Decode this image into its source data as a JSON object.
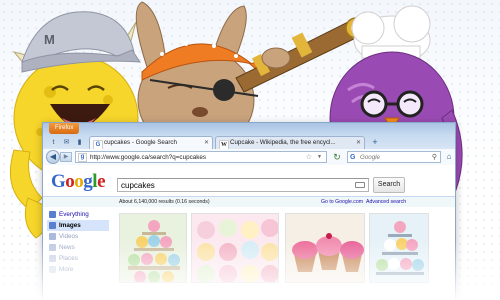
{
  "browser": {
    "app_menu_label": "Firefox",
    "tabs": [
      {
        "title": "cupcakes - Google Search",
        "favicon": "G"
      },
      {
        "title": "Cupcake - Wikipedia, the free encycl...",
        "favicon": "W"
      }
    ],
    "new_tab_label": "+",
    "address": "http://www.google.ca/search?q=cupcakes",
    "url_favicon": "g",
    "web_search_engine": "G",
    "web_search_placeholder": "Google"
  },
  "google": {
    "logo_letters": [
      {
        "ch": "G",
        "color": "#3366cc"
      },
      {
        "ch": "o",
        "color": "#cc2222"
      },
      {
        "ch": "o",
        "color": "#e8a900"
      },
      {
        "ch": "g",
        "color": "#3366cc"
      },
      {
        "ch": "l",
        "color": "#2a9a2a"
      },
      {
        "ch": "e",
        "color": "#cc2222"
      }
    ],
    "query": "cupcakes",
    "search_button": "Search",
    "results_count": "About 6,140,000 results (0.16 seconds)",
    "goto_link": "Go to Google.com",
    "advanced_link": "Advanced search"
  },
  "sidebar": [
    {
      "label": "Everything",
      "icon_color": "#5b7fcf"
    },
    {
      "label": "Images",
      "icon_color": "#5b7fcf",
      "selected": true
    },
    {
      "label": "Videos",
      "icon_color": "#8da3d4"
    },
    {
      "label": "News",
      "icon_color": "#a9b8d8"
    },
    {
      "label": "Places",
      "icon_color": "#bcc8e0"
    },
    {
      "label": "More",
      "icon_color": "#ccd5e6"
    }
  ],
  "colors": {
    "toolbar": "#cfe0f3",
    "accent": "#3366cc",
    "firefox_orange": "#e07a1f"
  }
}
